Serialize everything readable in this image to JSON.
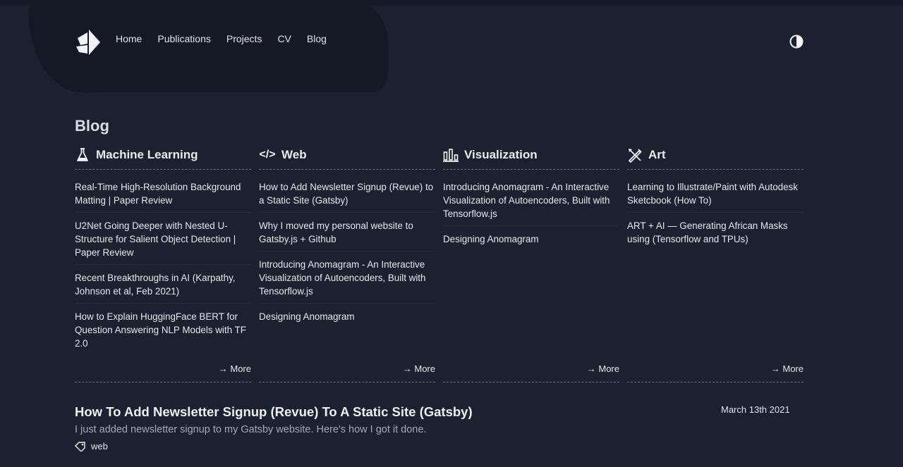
{
  "nav": {
    "items": [
      "Home",
      "Publications",
      "Projects",
      "CV",
      "Blog"
    ]
  },
  "page": {
    "title": "Blog"
  },
  "columns": [
    {
      "title": "Machine Learning",
      "icon": "flask-icon",
      "posts": [
        "Real-Time High-Resolution Background Matting | Paper Review",
        "U2Net Going Deeper with Nested U-Structure for Salient Object Detection | Paper Review",
        "Recent Breakthroughs in AI (Karpathy, Johnson et al, Feb 2021)",
        "How to Explain HuggingFace BERT for Question Answering NLP Models with TF 2.0"
      ],
      "more": "More"
    },
    {
      "title": "Web",
      "icon": "code-icon",
      "posts": [
        "How to Add Newsletter Signup (Revue) to a Static Site (Gatsby)",
        "Why I moved my personal website to Gatsby.js + Github",
        "Introducing Anomagram - An Interactive Visualization of Autoencoders, Built with Tensorflow.js",
        "Designing Anomagram"
      ],
      "more": "More"
    },
    {
      "title": "Visualization",
      "icon": "bar-chart-icon",
      "posts": [
        "Introducing Anomagram - An Interactive Visualization of Autoencoders, Built with Tensorflow.js",
        "Designing Anomagram"
      ],
      "more": "More"
    },
    {
      "title": "Art",
      "icon": "pencil-brush-icon",
      "posts": [
        "Learning to Illustrate/Paint with Autodesk Sketcbook (How To)",
        "ART + AI — Generating African Masks using (Tensorflow and TPUs)"
      ],
      "more": "More"
    }
  ],
  "featured": {
    "title": "How To Add Newsletter Signup (Revue) To A Static Site (Gatsby)",
    "date": "March 13th 2021",
    "description": "I just added newsletter signup to my Gatsby website. Here's how I got it done.",
    "tag": "web"
  },
  "colors": {
    "background": "#1c2130",
    "text": "#e6e8ee",
    "muted": "#a4a9b6"
  }
}
